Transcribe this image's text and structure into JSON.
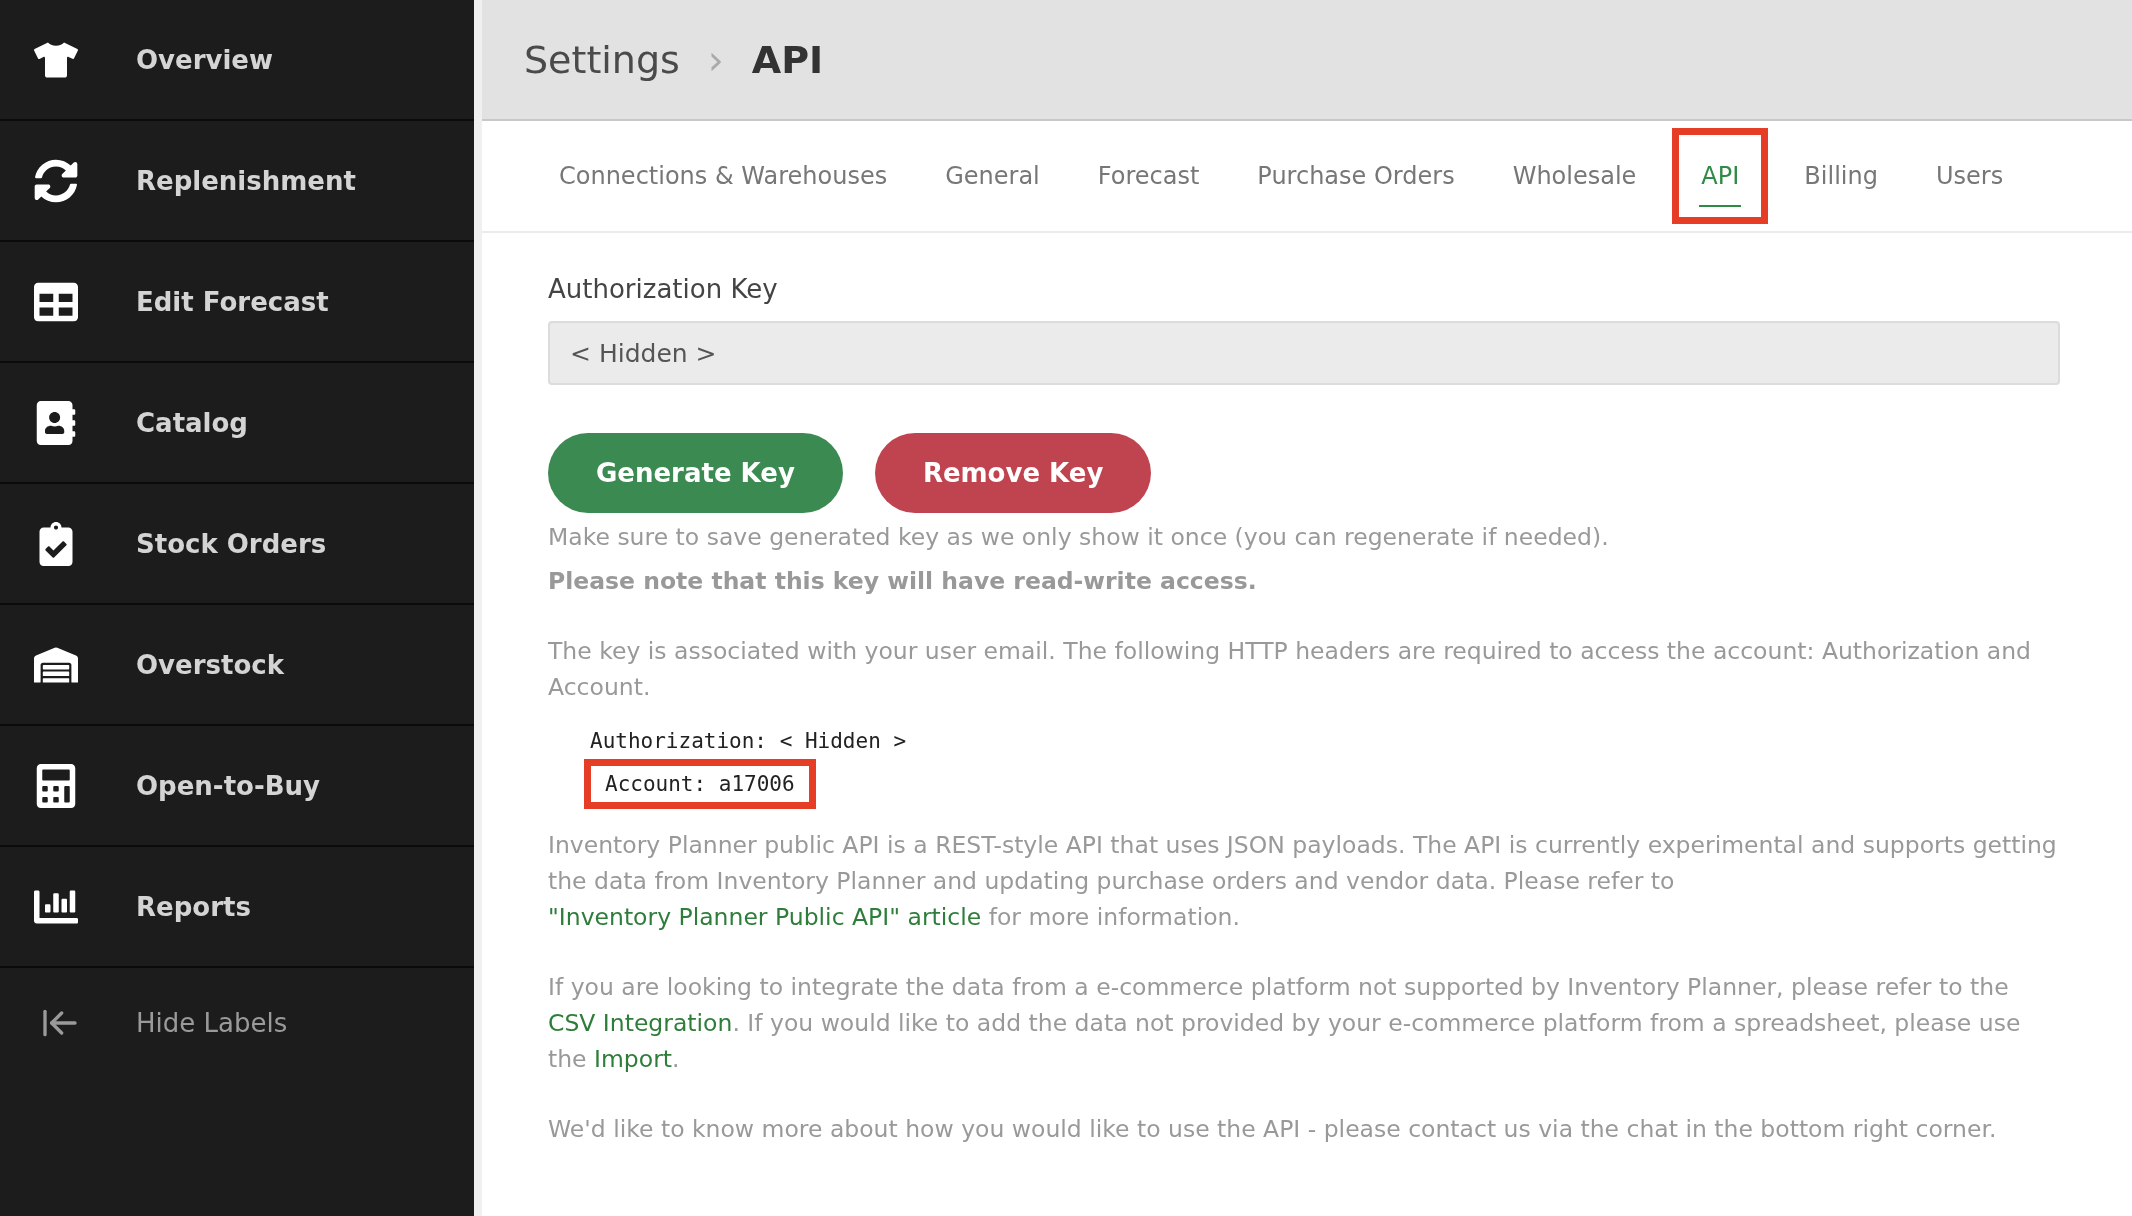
{
  "sidebar": {
    "items": [
      {
        "kind": "overview",
        "label": "Overview"
      },
      {
        "kind": "replenishment",
        "label": "Replenishment"
      },
      {
        "kind": "forecast",
        "label": "Edit Forecast"
      },
      {
        "kind": "catalog",
        "label": "Catalog"
      },
      {
        "kind": "orders",
        "label": "Stock Orders"
      },
      {
        "kind": "overstock",
        "label": "Overstock"
      },
      {
        "kind": "budget",
        "label": "Open-to-Buy"
      },
      {
        "kind": "reports",
        "label": "Reports"
      }
    ],
    "toggle": {
      "label": "Hide Labels"
    }
  },
  "breadcrumb": [
    {
      "label": "Settings",
      "current": false
    },
    {
      "label": "API",
      "current": true
    }
  ],
  "breadcrumb_separator": "›",
  "tabs": [
    {
      "label": "Connections & Warehouses",
      "selected": false,
      "highlighted": false
    },
    {
      "label": "General",
      "selected": false,
      "highlighted": false
    },
    {
      "label": "Forecast",
      "selected": false,
      "highlighted": false
    },
    {
      "label": "Purchase Orders",
      "selected": false,
      "highlighted": false
    },
    {
      "label": "Wholesale",
      "selected": false,
      "highlighted": false
    },
    {
      "label": "API",
      "selected": true,
      "highlighted": true
    },
    {
      "label": "Billing",
      "selected": false,
      "highlighted": false
    },
    {
      "label": "Users",
      "selected": false,
      "highlighted": false
    }
  ],
  "auth_key": {
    "label": "Authorization Key",
    "value": "< Hidden >"
  },
  "buttons": [
    {
      "kind": "primary",
      "label": "Generate Key"
    },
    {
      "kind": "danger",
      "label": "Remove Key"
    }
  ],
  "note": "Make sure to save generated key as we only show it once (you can regenerate if needed).",
  "warning": "Please note that this key will have read-write access.",
  "headers_intro": "The key is associated with your user email. The following HTTP headers are required to access the account: Authorization and Account.",
  "code_lines": [
    {
      "text": "Authorization: < Hidden >",
      "highlighted": false
    },
    {
      "text": "Account: a17006",
      "highlighted": true
    }
  ],
  "paragraphs": [
    [
      {
        "kind": "text",
        "text": "Inventory Planner public API is a REST-style API that uses JSON payloads. The API is currently experimental and supports getting the data from Inventory Planner and updating purchase orders and vendor data. Please refer to "
      },
      {
        "kind": "link",
        "text": "\"Inventory Planner Public API\" article"
      },
      {
        "kind": "text",
        "text": " for more information."
      }
    ],
    [
      {
        "kind": "text",
        "text": "If you are looking to integrate the data from a e-commerce platform not supported by Inventory Planner, please refer to the "
      },
      {
        "kind": "link",
        "text": "CSV Integration"
      },
      {
        "kind": "text",
        "text": ". If you would like to add the data not provided by your e-commerce platform from a spreadsheet, please use the "
      },
      {
        "kind": "link",
        "text": "Import"
      },
      {
        "kind": "text",
        "text": "."
      }
    ],
    [
      {
        "kind": "text",
        "text": "We'd like to know more about how you would like to use the API - please contact us via the chat in the bottom right corner."
      }
    ]
  ]
}
